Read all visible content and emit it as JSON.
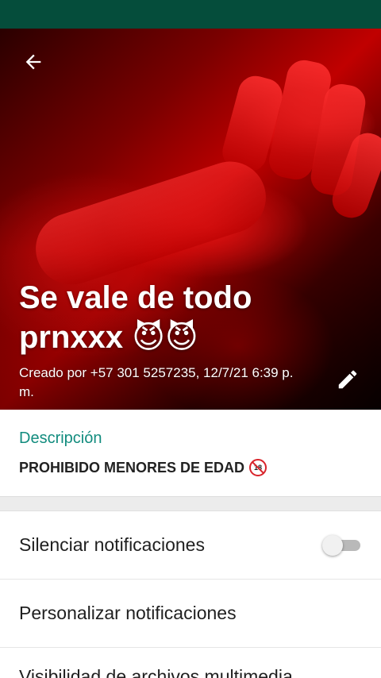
{
  "colors": {
    "status_bar": "#054d3b",
    "accent": "#128c7e",
    "header_red": "#c00000"
  },
  "header": {
    "back_icon": "arrow-left-icon",
    "title": "Se vale de todo prnxxx 😈😈",
    "created_by": "Creado por +57 301 5257235, 12/7/21 6:39 p. m.",
    "edit_icon": "pencil-icon"
  },
  "description": {
    "label": "Descripción",
    "text": "PROHIBIDO MENORES DE EDAD",
    "badge_text": "18",
    "badge_icon": "no-under-18-icon"
  },
  "settings": {
    "mute_label": "Silenciar notificaciones",
    "mute_enabled": false,
    "custom_label": "Personalizar notificaciones",
    "media_label": "Visibilidad de archivos multimedia"
  }
}
